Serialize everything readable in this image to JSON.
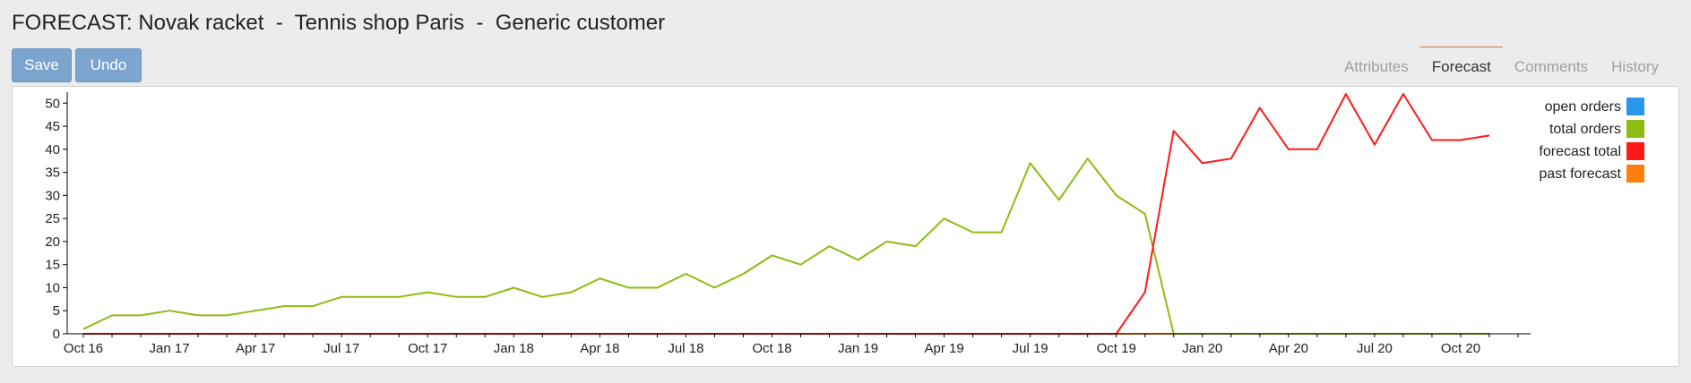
{
  "header": {
    "title": "FORECAST: Novak racket  -  Tennis shop Paris  -  Generic customer",
    "save_label": "Save",
    "undo_label": "Undo"
  },
  "tabs": [
    {
      "label": "Attributes",
      "active": false
    },
    {
      "label": "Forecast",
      "active": true
    },
    {
      "label": "Comments",
      "active": false
    },
    {
      "label": "History",
      "active": false
    }
  ],
  "chart_data": {
    "type": "line",
    "title": "",
    "xlabel": "",
    "ylabel": "",
    "ylim": [
      0,
      52
    ],
    "yticks": [
      0,
      5,
      10,
      15,
      20,
      25,
      30,
      35,
      40,
      45,
      50
    ],
    "xtick_labels": [
      "Oct 16",
      "Jan 17",
      "Apr 17",
      "Jul 17",
      "Oct 17",
      "Jan 18",
      "Apr 18",
      "Jul 18",
      "Oct 18",
      "Jan 19",
      "Apr 19",
      "Jul 19",
      "Oct 19",
      "Jan 20",
      "Apr 20",
      "Jul 20",
      "Oct 20"
    ],
    "x": [
      "Oct 16",
      "Nov 16",
      "Dec 16",
      "Jan 17",
      "Feb 17",
      "Mar 17",
      "Apr 17",
      "May 17",
      "Jun 17",
      "Jul 17",
      "Aug 17",
      "Sep 17",
      "Oct 17",
      "Nov 17",
      "Dec 17",
      "Jan 18",
      "Feb 18",
      "Mar 18",
      "Apr 18",
      "May 18",
      "Jun 18",
      "Jul 18",
      "Aug 18",
      "Sep 18",
      "Oct 18",
      "Nov 18",
      "Dec 18",
      "Jan 19",
      "Feb 19",
      "Mar 19",
      "Apr 19",
      "May 19",
      "Jun 19",
      "Jul 19",
      "Aug 19",
      "Sep 19",
      "Oct 19",
      "Nov 19",
      "Dec 19",
      "Jan 20",
      "Feb 20",
      "Mar 20",
      "Apr 20",
      "May 20",
      "Jun 20",
      "Jul 20",
      "Aug 20",
      "Sep 20",
      "Oct 20",
      "Nov 20"
    ],
    "series": [
      {
        "name": "open orders",
        "color": "#2b96ee",
        "values": [
          0,
          0,
          0,
          0,
          0,
          0,
          0,
          0,
          0,
          0,
          0,
          0,
          0,
          0,
          0,
          0,
          0,
          0,
          0,
          0,
          0,
          0,
          0,
          0,
          0,
          0,
          0,
          0,
          0,
          0,
          0,
          0,
          0,
          0,
          0,
          0,
          0,
          0,
          0,
          0,
          0,
          0,
          0,
          0,
          0,
          0,
          0,
          0,
          0,
          0
        ]
      },
      {
        "name": "total orders",
        "color": "#8cbd10",
        "values": [
          1,
          4,
          4,
          5,
          4,
          4,
          5,
          6,
          6,
          8,
          8,
          8,
          9,
          8,
          8,
          10,
          8,
          9,
          12,
          10,
          10,
          13,
          10,
          13,
          17,
          15,
          19,
          16,
          20,
          19,
          25,
          22,
          22,
          37,
          29,
          38,
          30,
          26,
          0,
          0,
          0,
          0,
          0,
          0,
          0,
          0,
          0,
          0,
          0,
          0
        ]
      },
      {
        "name": "forecast total",
        "color": "#ff1a1a",
        "values": [
          0,
          0,
          0,
          0,
          0,
          0,
          0,
          0,
          0,
          0,
          0,
          0,
          0,
          0,
          0,
          0,
          0,
          0,
          0,
          0,
          0,
          0,
          0,
          0,
          0,
          0,
          0,
          0,
          0,
          0,
          0,
          0,
          0,
          0,
          0,
          0,
          0,
          9,
          44,
          37,
          38,
          49,
          40,
          40,
          52,
          41,
          52,
          42,
          42,
          43
        ]
      },
      {
        "name": "past forecast",
        "color": "#ff7f0e",
        "values": [
          0,
          0,
          0,
          0,
          0,
          0,
          0,
          0,
          0,
          0,
          0,
          0,
          0,
          0,
          0,
          0,
          0,
          0,
          0,
          0,
          0,
          0,
          0,
          0,
          0,
          0,
          0,
          0,
          0,
          0,
          0,
          0,
          0,
          0,
          0,
          0,
          0,
          0,
          0,
          0,
          0,
          0,
          0,
          0,
          0,
          0,
          0,
          0,
          0,
          0
        ]
      }
    ],
    "grid": false,
    "legend_position": "top-right"
  }
}
